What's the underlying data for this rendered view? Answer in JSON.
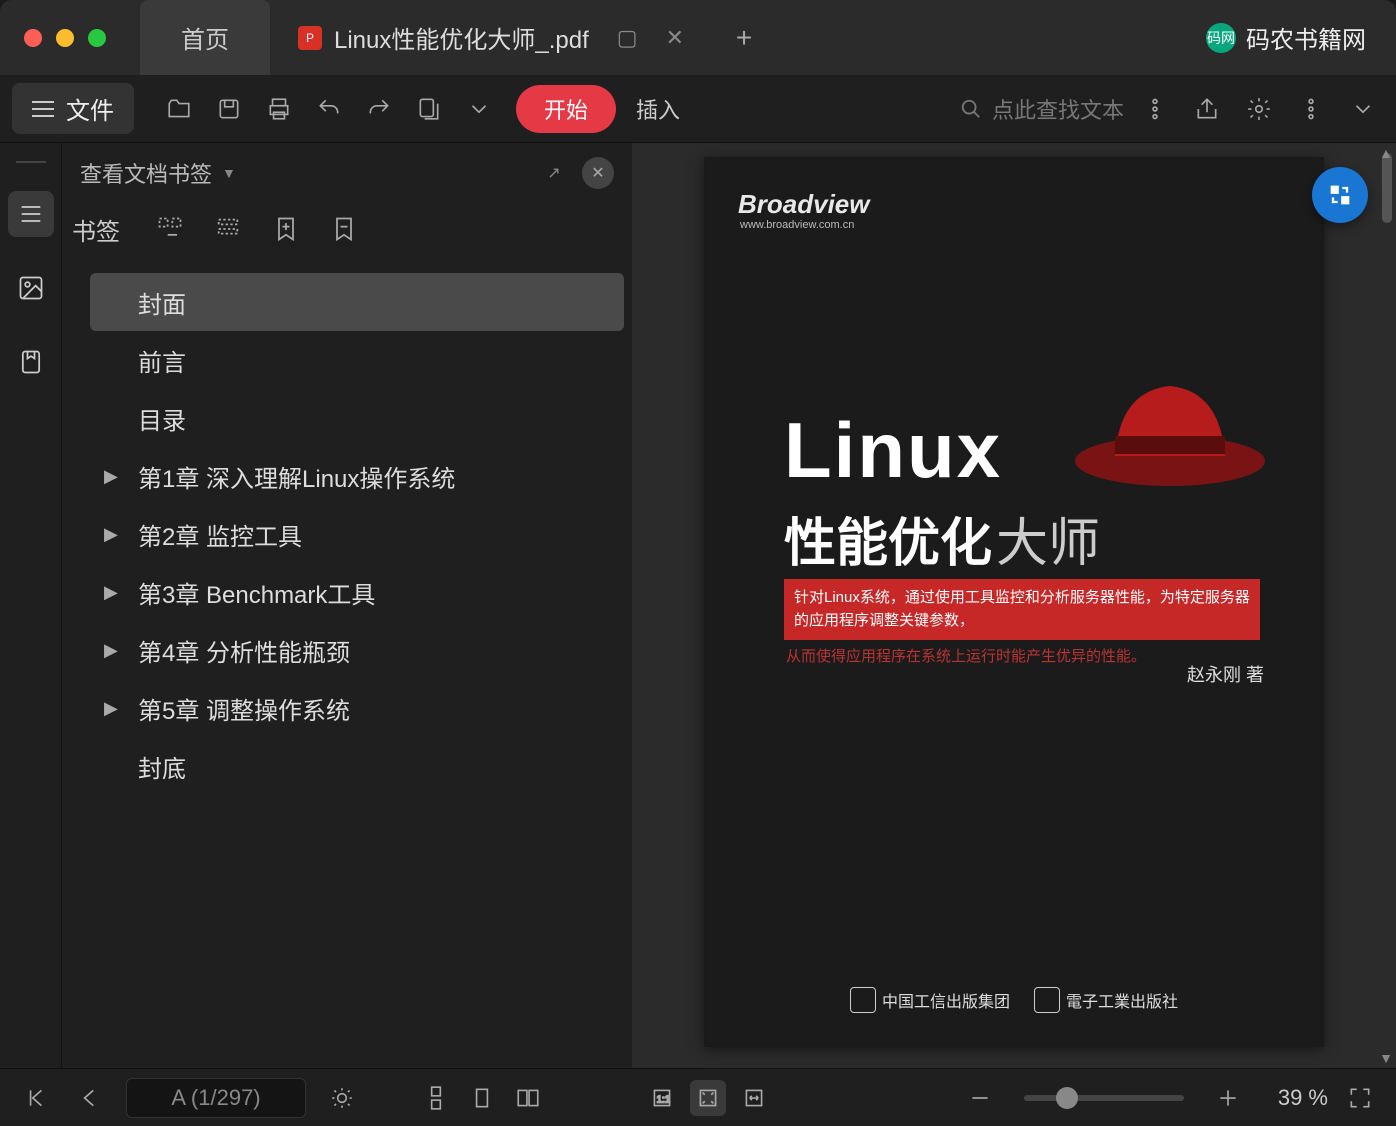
{
  "titlebar": {
    "home_tab": "首页",
    "doc_tab": "Linux性能优化大师_.pdf",
    "brand": "码农书籍网",
    "brand_badge": "码网"
  },
  "toolbar": {
    "file_label": "文件",
    "start_label": "开始",
    "insert_label": "插入",
    "search_placeholder": "点此查找文本"
  },
  "sidebar": {
    "panel_title": "查看文档书签",
    "bookmarks_label": "书签",
    "items": [
      {
        "label": "封面",
        "expandable": false,
        "selected": true
      },
      {
        "label": "前言",
        "expandable": false,
        "selected": false
      },
      {
        "label": "目录",
        "expandable": false,
        "selected": false
      },
      {
        "label": "第1章  深入理解Linux操作系统",
        "expandable": true,
        "selected": false
      },
      {
        "label": "第2章  监控工具",
        "expandable": true,
        "selected": false
      },
      {
        "label": "第3章  Benchmark工具",
        "expandable": true,
        "selected": false
      },
      {
        "label": "第4章  分析性能瓶颈",
        "expandable": true,
        "selected": false
      },
      {
        "label": "第5章  调整操作系统",
        "expandable": true,
        "selected": false
      },
      {
        "label": "封底",
        "expandable": false,
        "selected": false
      }
    ]
  },
  "page": {
    "broadview": "Broadview",
    "broadview_url": "www.broadview.com.cn",
    "title": "Linux",
    "subtitle_bold": "性能优化",
    "subtitle_light": "大师",
    "strip_text": "针对Linux系统，通过使用工具监控和分析服务器性能，为特定服务器的应用程序调整关键参数，",
    "tagline": "从而使得应用程序在系统上运行时能产生优异的性能。",
    "author": "赵永刚  著",
    "publisher1": "中国工信出版集团",
    "publisher2": "電子工業出版社"
  },
  "statusbar": {
    "page_indicator": "A (1/297)",
    "zoom_label": "39 %"
  }
}
